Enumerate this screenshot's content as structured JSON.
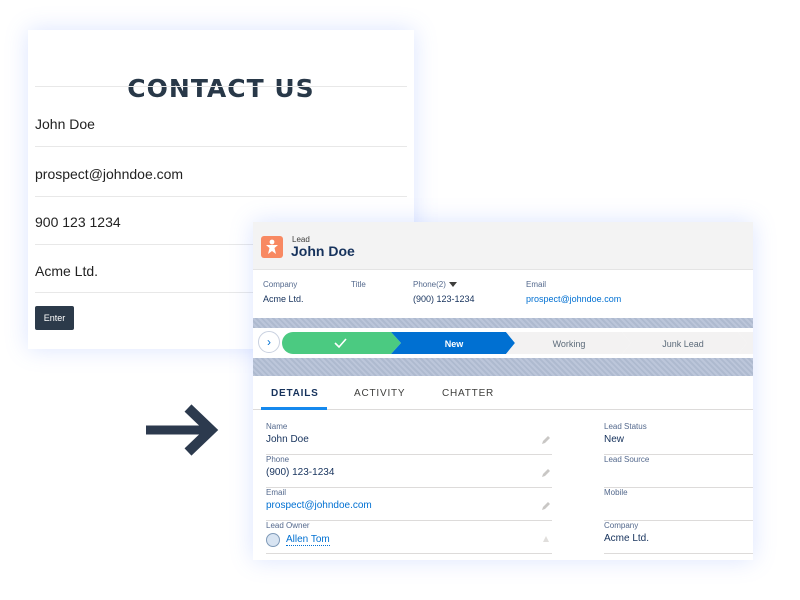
{
  "contact_form": {
    "title": "CONTACT US",
    "fields": [
      "John Doe",
      "prospect@johndoe.com",
      "900 123 1234",
      "Acme Ltd."
    ],
    "enter_label": "Enter"
  },
  "lead": {
    "object_label": "Lead",
    "name": "John Doe",
    "highlights": {
      "company_label": "Company",
      "company_value": "Acme Ltd.",
      "title_label": "Title",
      "phone_label": "Phone(2)",
      "phone_value": "(900) 123-1234",
      "email_label": "Email",
      "email_value": "prospect@johndoe.com"
    },
    "path": {
      "steps": [
        "",
        "New",
        "Working",
        "Junk Lead"
      ],
      "current": "New"
    },
    "tabs": [
      "DETAILS",
      "ACTIVITY",
      "CHATTER"
    ],
    "active_tab": "DETAILS",
    "details_left": [
      {
        "label": "Name",
        "value": "John Doe"
      },
      {
        "label": "Phone",
        "value": "(900) 123-1234"
      },
      {
        "label": "Email",
        "value": "prospect@johndoe.com"
      },
      {
        "label": "Lead Owner",
        "value": "Allen Tom"
      }
    ],
    "details_right": [
      {
        "label": "Lead Status",
        "value": "New"
      },
      {
        "label": "Lead Source",
        "value": ""
      },
      {
        "label": "Mobile",
        "value": ""
      },
      {
        "label": "Company",
        "value": "Acme Ltd."
      }
    ]
  },
  "colors": {
    "path_complete": "#4bca81",
    "path_current": "#0070d2",
    "path_incomplete": "#f3f2f2",
    "lead_icon": "#f88962",
    "link": "#0070d2"
  },
  "icons": {
    "lead_icon": "lead-icon",
    "arrow": "arrow-right-icon",
    "check": "check-icon",
    "pencil": "pencil-icon",
    "dropdown": "chevron-down-icon",
    "path_toggle": "chevron-right-icon"
  }
}
